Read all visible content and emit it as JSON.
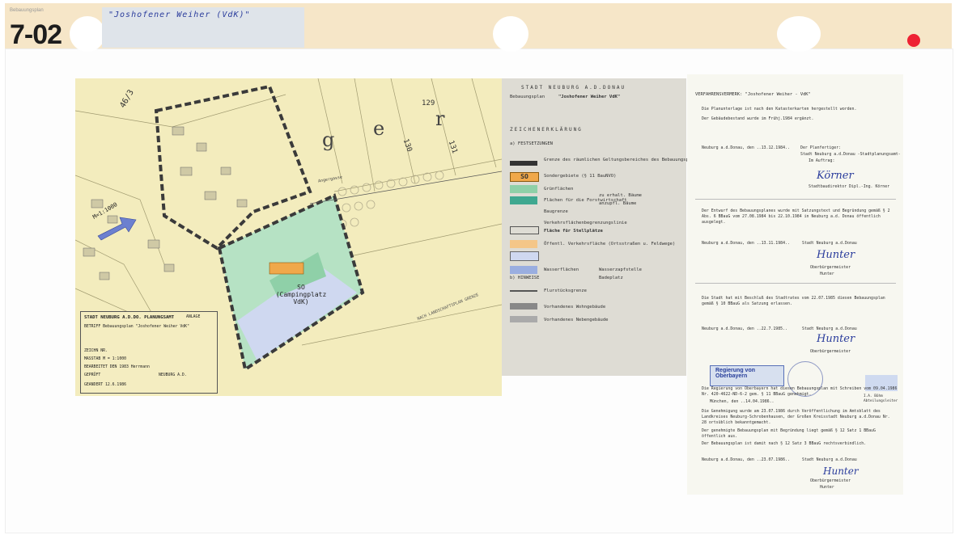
{
  "sheet": {
    "number": "7-02",
    "label": "\"Joshofener Weiher (VdK)\"",
    "top_faint": "Bebauungsplan"
  },
  "map": {
    "parcels": [
      "46/3",
      "129",
      "130",
      "131",
      "g",
      "e",
      "r"
    ],
    "scale": "M=1:1000",
    "zone_label": "SO (Campingplatz VdK)",
    "road_label": "Angergasse",
    "landscape_note": "NACH LANDSCHAFTSPLAN GRENZE",
    "scale_field": "M=1:1000"
  },
  "title_block": {
    "office": "STADT NEUBURG A.D.DO. PLANUNGSAMT",
    "anlage": "ANLAGE",
    "betreff": "BETRIFF Bebauungsplan \"Joshofener Weiher VdK\"",
    "zeichn": "ZEICHN NR.",
    "massstab": "MASSTAB  M = 1:1000",
    "bearbeitet": "BEARBEITET DEN 1983 Herrmann",
    "geprueft": "GEPRÜFT",
    "neuburg": "NEUBURG A.D.",
    "gefertigt": "GEANDERT  12.6.1986"
  },
  "legend": {
    "header": "STADT NEUBURG A.D.DONAU",
    "plan_label": "Bebauungsplan",
    "plan_name": "\"Joshofener Weiher VdK\"",
    "section_title": "ZEICHENERKLÄRUNG",
    "subsection": "a) FESTSETZUNGEN",
    "items": [
      {
        "text": "Grenze des räumlichen Geltungsbereiches des Bebauungsplanes"
      },
      {
        "text": "Sondergebiete (§ 11 BauNVO)",
        "code": "SO"
      },
      {
        "text": "Grünflächen"
      },
      {
        "text": "Flächen für die Forstwirtschaft"
      },
      {
        "text": "Baugrenze"
      },
      {
        "text": "Fläche für Stellplätze"
      },
      {
        "text": "Öffentl. Verkehrsfläche (Ortsstraßen u. Feldwege)"
      },
      {
        "text": "Wasserflächen"
      },
      {
        "text": "Wasserzapfstelle"
      },
      {
        "text": "Flurstücksgrenze"
      },
      {
        "text": "Vorhandenes Wohngebäude"
      },
      {
        "text": "Vorhandenes Nebengebäude"
      }
    ],
    "legend_note_1": "zu erhalt. Bäume",
    "legend_note_2": "anzupfl. Bäume",
    "legend_note_3": "Badeplatz",
    "hinweise": "b) HINWEISE",
    "sketch_1": "Verkehrsflächenbegrenzungslinie"
  },
  "proc": {
    "title": "VERFAHRENSVERMERK: \"Joshofener Weiher - VdK\"",
    "p1": "Die Planunterlage ist nach den Katasterkarten hergestellt worden.",
    "p2": "Der Gebäudebestand wurde im  Frühj.1984 ergänzt.",
    "date_1": "Neuburg a.d.Donau, den ..13.12.1984..",
    "signer_1_role": "Der Planfertiger:",
    "signer_1_org": "Stadt Neuburg a.d.Donau -Stadtplanungsamt-",
    "signer_1_auftrag": "Im Auftrag:",
    "signer_1_name": "Stadtbaudirektor Dipl.-Ing. Körner",
    "p3": "Der Entwurf des Bebauungsplanes wurde mit Satzungstext und Begründung gemäß § 2 Abs. 6 BBauG vom 27.08.1984 bis 22.10.1984 in Neuburg a.d. Donau öffentlich ausgelegt.",
    "date_2": "Neuburg a.d.Donau, den ..13.11.1984..",
    "city_2": "Stadt Neuburg a.d.Donau",
    "mayor": "Oberbürgermeister",
    "mayor_name": "Hunter",
    "p4": "Die Stadt hat mit Beschluß des Stadtrates vom 22.07.1985 diesen Bebauungsplan gemäß § 10 BBauG als Satzung erlassen.",
    "date_3": "Neuburg a.d.Donau, den ..22.7.1985..",
    "city_3": "Stadt Neuburg a.d.Donau",
    "mayor_3": "Oberbürgermeister",
    "stamp_label": "Regierung von Oberbayern",
    "p5": "Die Regierung von Oberbayern hat diesen Bebauungsplan mit Schreiben vom 09.04.1986 Nr. 420-4622-ND-6-2 gem. § 11 BBauG genehmigt.",
    "date_5": "München, den ..14.04.1986..",
    "stamp_note": "I.A. Böhm Abteilungsleiter",
    "p6": "Die Genehmigung wurde am 23.07.1986 durch Veröffentlichung im Amtsblatt des Landkreises Neuburg-Schrobenhausen, der Großen Kreisstadt Neuburg a.d.Donau Nr. 28 ortsüblich bekanntgemacht.",
    "p7": "Der genehmigte Bebauungsplan mit Begründung liegt gemäß § 12 Satz 1 BBauG öffentlich aus.",
    "p8": "Der Bebauungsplan ist damit nach § 12 Satz 3 BBauG rechtsverbindlich.",
    "date_6": "Neuburg a.d.Donau, den ..23.07.1986..",
    "city_6": "Stadt Neuburg a.d.Donau",
    "mayor_6": "Oberbürgermeister",
    "mayor_6_name": "Hunter"
  },
  "colors": {
    "tape": "#f6e6c8",
    "map_base": "#f3ecbd",
    "green_area": "#8fd0a8",
    "water": "#cfd8f0",
    "boundary": "#3a3a3a",
    "ink_blue": "#2a3c9c",
    "red_dot": "#ee2233"
  }
}
